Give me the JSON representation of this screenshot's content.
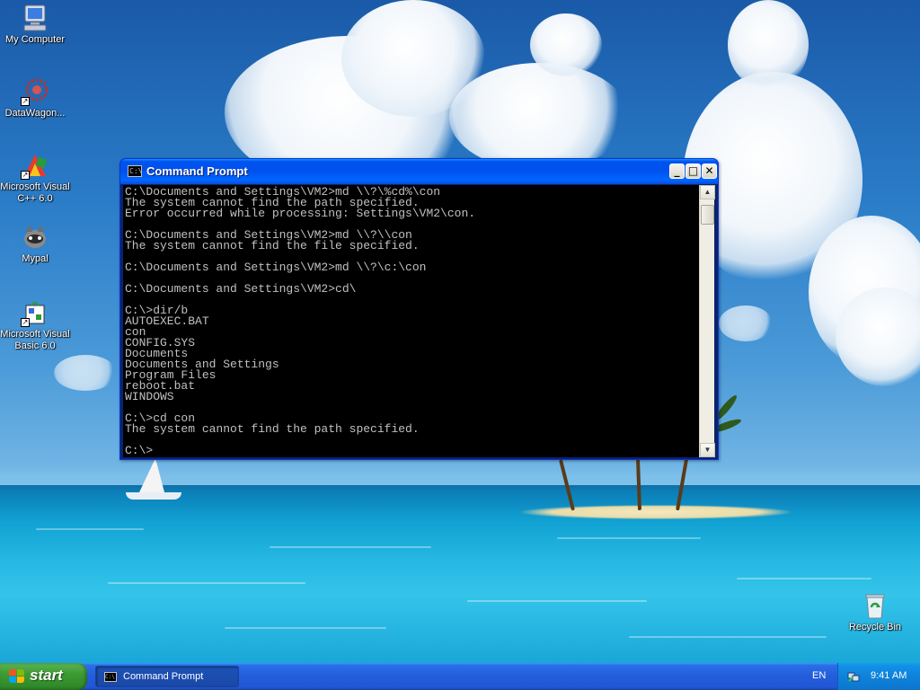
{
  "desktop": {
    "icons": [
      {
        "label": "My Computer",
        "icon": "computer-icon"
      },
      {
        "label": "DataWagon...",
        "icon": "datawagon-icon"
      },
      {
        "label_line1": "Microsoft Visual",
        "label_line2": "C++ 6.0",
        "icon": "visual-cpp-icon"
      },
      {
        "label": "Mypal",
        "icon": "mypal-icon"
      },
      {
        "label_line1": "Microsoft Visual",
        "label_line2": "Basic 6.0",
        "icon": "visual-basic-icon"
      },
      {
        "label": "Recycle Bin",
        "icon": "recycle-bin-icon"
      }
    ]
  },
  "window": {
    "title": "Command Prompt",
    "icon_text": "C:\\",
    "buttons": {
      "minimize": "_",
      "maximize": "□",
      "close": "✕"
    },
    "console_lines": [
      "C:\\Documents and Settings\\VM2>md \\\\?\\%cd%\\con",
      "The system cannot find the path specified.",
      "Error occurred while processing: Settings\\VM2\\con.",
      "",
      "C:\\Documents and Settings\\VM2>md \\\\?\\\\con",
      "The system cannot find the file specified.",
      "",
      "C:\\Documents and Settings\\VM2>md \\\\?\\c:\\con",
      "",
      "C:\\Documents and Settings\\VM2>cd\\",
      "",
      "C:\\>dir/b",
      "AUTOEXEC.BAT",
      "con",
      "CONFIG.SYS",
      "Documents",
      "Documents and Settings",
      "Program Files",
      "reboot.bat",
      "WINDOWS",
      "",
      "C:\\>cd con",
      "The system cannot find the path specified.",
      "",
      "C:\\>"
    ]
  },
  "taskbar": {
    "start_label": "start",
    "tasks": [
      {
        "label": "Command Prompt",
        "icon_text": "C:\\"
      }
    ],
    "language": "EN",
    "clock": "9:41 AM"
  },
  "colors": {
    "console_bg": "#000000",
    "console_fg": "#c0c0c0",
    "titlebar": "#0054e3",
    "taskbar": "#245edb",
    "start_green": "#3d9b33"
  }
}
